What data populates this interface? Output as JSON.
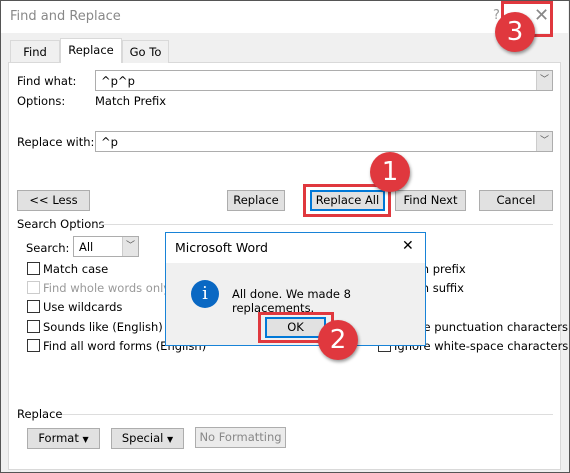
{
  "window": {
    "title": "Find and Replace",
    "help": "?",
    "close": "✕"
  },
  "tabs": [
    {
      "label": "Find"
    },
    {
      "label": "Replace"
    },
    {
      "label": "Go To"
    }
  ],
  "find": {
    "label": "Find what:",
    "value": "^p^p",
    "options_label": "Options:",
    "options_value": "Match Prefix"
  },
  "replace": {
    "label": "Replace with:",
    "value": "^p"
  },
  "buttons": {
    "less": "<< Less",
    "replace": "Replace",
    "replace_all": "Replace All",
    "find_next": "Find Next",
    "cancel": "Cancel"
  },
  "search_options": {
    "heading": "Search Options",
    "search_label": "Search:",
    "search_value": "All",
    "left": [
      {
        "label": "Match case",
        "checked": false,
        "disabled": false
      },
      {
        "label": "Find whole words only",
        "checked": false,
        "disabled": true
      },
      {
        "label": "Use wildcards",
        "checked": false,
        "disabled": false
      },
      {
        "label": "Sounds like (English)",
        "checked": false,
        "disabled": false
      },
      {
        "label": "Find all word forms (English)",
        "checked": false,
        "disabled": false
      }
    ],
    "right": [
      {
        "label": "Match prefix"
      },
      {
        "label": "Match suffix"
      },
      {
        "label": "Ignore punctuation characters"
      },
      {
        "label": "Ignore white-space characters"
      }
    ]
  },
  "replace_section": {
    "heading": "Replace",
    "format": "Format",
    "special": "Special",
    "no_formatting": "No Formatting"
  },
  "popup": {
    "title": "Microsoft Word",
    "message": "All done. We made 8 replacements.",
    "ok": "OK",
    "close": "✕",
    "icon": "info-icon"
  },
  "annotations": [
    "1",
    "2",
    "3"
  ],
  "colors": {
    "highlight": "#e0383e",
    "focus": "#0078d7",
    "info": "#0a68c3"
  }
}
